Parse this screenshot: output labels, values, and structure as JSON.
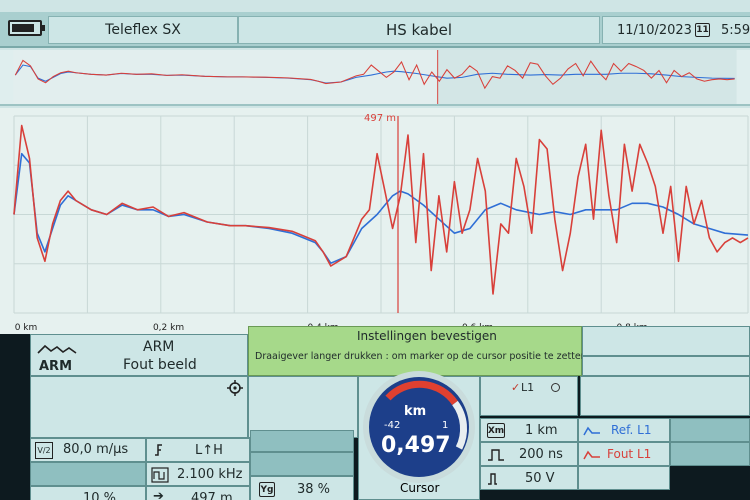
{
  "header": {
    "device": "Teleflex SX",
    "mode": "HS kabel",
    "date": "11/10/2023",
    "time": "5:59"
  },
  "chart_data": {
    "type": "line",
    "xlabel": "",
    "ylabel": "",
    "xlim": [
      0,
      0.95
    ],
    "x_ticks": [
      "0 km",
      "0,2 km",
      "0,4 km",
      "0,6 km",
      "0,8 km"
    ],
    "cursor_label": "497 m",
    "cursor_x": 0.497,
    "grid": true,
    "series": [
      {
        "name": "Ref. L1",
        "color": "#2f6fd6",
        "x": [
          0.0,
          0.01,
          0.02,
          0.03,
          0.04,
          0.05,
          0.06,
          0.07,
          0.08,
          0.1,
          0.12,
          0.14,
          0.16,
          0.18,
          0.2,
          0.22,
          0.25,
          0.28,
          0.3,
          0.33,
          0.36,
          0.39,
          0.4,
          0.41,
          0.43,
          0.44,
          0.45,
          0.47,
          0.49,
          0.5,
          0.51,
          0.53,
          0.55,
          0.57,
          0.59,
          0.61,
          0.63,
          0.65,
          0.68,
          0.7,
          0.72,
          0.74,
          0.76,
          0.78,
          0.8,
          0.82,
          0.84,
          0.86,
          0.88,
          0.9,
          0.92,
          0.95
        ],
        "y": [
          0.0,
          0.65,
          0.55,
          -0.2,
          -0.4,
          -0.15,
          0.1,
          0.2,
          0.15,
          0.05,
          0.0,
          0.1,
          0.05,
          0.05,
          -0.02,
          0.0,
          -0.08,
          -0.12,
          -0.12,
          -0.15,
          -0.2,
          -0.3,
          -0.4,
          -0.52,
          -0.45,
          -0.3,
          -0.15,
          0.0,
          0.2,
          0.25,
          0.22,
          0.1,
          -0.05,
          -0.2,
          -0.15,
          0.05,
          0.12,
          0.05,
          0.0,
          0.03,
          0.0,
          0.05,
          0.05,
          0.05,
          0.12,
          0.12,
          0.08,
          0.0,
          -0.1,
          -0.15,
          -0.2,
          -0.22
        ]
      },
      {
        "name": "Fout L1",
        "color": "#d8403a",
        "x": [
          0.0,
          0.01,
          0.02,
          0.03,
          0.04,
          0.05,
          0.06,
          0.07,
          0.08,
          0.1,
          0.12,
          0.14,
          0.16,
          0.18,
          0.2,
          0.22,
          0.25,
          0.28,
          0.3,
          0.33,
          0.36,
          0.39,
          0.4,
          0.41,
          0.43,
          0.44,
          0.45,
          0.46,
          0.47,
          0.48,
          0.49,
          0.5,
          0.51,
          0.52,
          0.53,
          0.54,
          0.55,
          0.56,
          0.57,
          0.58,
          0.59,
          0.6,
          0.61,
          0.62,
          0.63,
          0.64,
          0.65,
          0.66,
          0.67,
          0.68,
          0.69,
          0.7,
          0.71,
          0.72,
          0.73,
          0.74,
          0.75,
          0.76,
          0.77,
          0.78,
          0.79,
          0.8,
          0.81,
          0.82,
          0.83,
          0.84,
          0.85,
          0.86,
          0.87,
          0.88,
          0.89,
          0.9,
          0.91,
          0.92,
          0.93,
          0.94,
          0.95
        ],
        "y": [
          0.0,
          0.95,
          0.6,
          -0.25,
          -0.5,
          -0.1,
          0.15,
          0.25,
          0.15,
          0.05,
          0.0,
          0.12,
          0.05,
          0.08,
          -0.02,
          0.02,
          -0.08,
          -0.12,
          -0.12,
          -0.14,
          -0.18,
          -0.28,
          -0.4,
          -0.55,
          -0.45,
          -0.25,
          -0.05,
          0.05,
          0.65,
          0.25,
          -0.15,
          0.2,
          0.85,
          -0.3,
          0.65,
          -0.6,
          0.2,
          -0.4,
          0.35,
          -0.2,
          0.05,
          0.6,
          0.25,
          -0.85,
          -0.1,
          -0.2,
          0.6,
          0.3,
          -0.2,
          0.8,
          0.7,
          -0.05,
          -0.6,
          -0.2,
          0.4,
          0.75,
          -0.05,
          0.9,
          0.2,
          -0.3,
          0.75,
          0.25,
          0.75,
          0.55,
          0.3,
          -0.2,
          0.3,
          -0.5,
          0.3,
          -0.1,
          0.15,
          -0.25,
          -0.4,
          -0.3,
          -0.25,
          -0.3,
          -0.25
        ]
      }
    ]
  },
  "panel": {
    "mode_short": "ARM",
    "mode_title": "ARM",
    "mode_subtitle": "Fout beeld",
    "notice_title": "Instellingen bevestigen",
    "notice_text": "Draaigever langer drukken :  om marker op de cursor positie te zetten",
    "velocity_label": "V/2",
    "velocity": "80,0 m/µs",
    "impulse": "L↑H",
    "frequency": "2.100 kHz",
    "gain": "10 %",
    "cursor_pos": "497 m",
    "yg_label": "Yg",
    "yg_value": "38 %",
    "dial_unit": "km",
    "dial_min": "-42",
    "dial_max": "1",
    "dial_value": "0,497",
    "dial_caption": "Cursor",
    "l1_label": "L1",
    "range_value": "1 km",
    "pulse_value": "200 ns",
    "voltage_value": "50 V",
    "xm_label": "Xm",
    "legend_ref": "Ref. L1",
    "legend_fault": "Fout L1",
    "colors": {
      "ref": "#2f6fd6",
      "fault": "#d8403a",
      "accent": "#a6d98a",
      "dial": "#1d3f8a"
    }
  }
}
